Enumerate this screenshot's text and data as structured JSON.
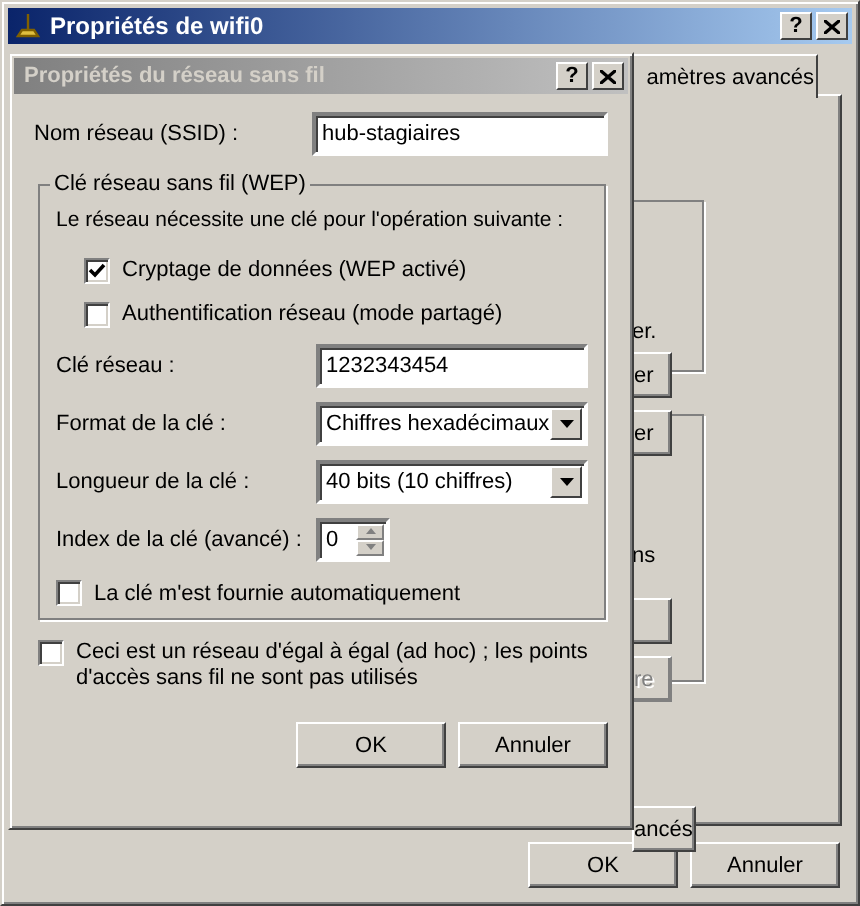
{
  "main_window": {
    "title": "Propriétés de wifi0",
    "active": true,
    "help_button": "?",
    "tab": {
      "label": "amètres avancés",
      "selected": true
    },
    "hidden_items": [
      {
        "kind": "text",
        "label": "er."
      },
      {
        "kind": "button",
        "label": "er",
        "disabled": false
      },
      {
        "kind": "button",
        "label": "er",
        "disabled": false
      },
      {
        "kind": "text",
        "label": "ns"
      },
      {
        "kind": "button",
        "disabled": false
      },
      {
        "kind": "button",
        "label": "re",
        "disabled": true
      },
      {
        "kind": "button",
        "label": "ancés",
        "disabled": false
      }
    ],
    "buttons": [
      {
        "label": "OK"
      },
      {
        "label": "Annuler"
      }
    ]
  },
  "dialog": {
    "title": "Propriétés du réseau sans fil",
    "active": false,
    "help_button": "?",
    "ssid": {
      "label": "Nom réseau (SSID) :",
      "value": "hub-stagiaires"
    },
    "wep_group": {
      "title": "Clé réseau sans fil (WEP)",
      "intro": "Le réseau nécessite une clé pour l'opération suivante :",
      "options": [
        {
          "label": "Cryptage de données (WEP activé)",
          "checked": true
        },
        {
          "label": "Authentification réseau (mode partagé)",
          "checked": false
        }
      ],
      "fields": [
        {
          "kind": "text",
          "label": "Clé réseau :",
          "value": "1232343454"
        },
        {
          "kind": "select",
          "label": "Format de la clé :",
          "value": "Chiffres hexadécimaux"
        },
        {
          "kind": "select",
          "label": "Longueur de la clé :",
          "value": "40 bits (10 chiffres)"
        },
        {
          "kind": "spin",
          "label": "Index de la clé (avancé) :",
          "value": "0"
        }
      ],
      "auto_key": {
        "label": "La clé m'est fournie automatiquement",
        "checked": false
      }
    },
    "adhoc": {
      "label": "Ceci est un réseau d'égal à égal (ad hoc) ; les points d'accès sans fil ne sont pas utilisés",
      "checked": false
    },
    "buttons": [
      {
        "label": "OK"
      },
      {
        "label": "Annuler"
      }
    ]
  }
}
